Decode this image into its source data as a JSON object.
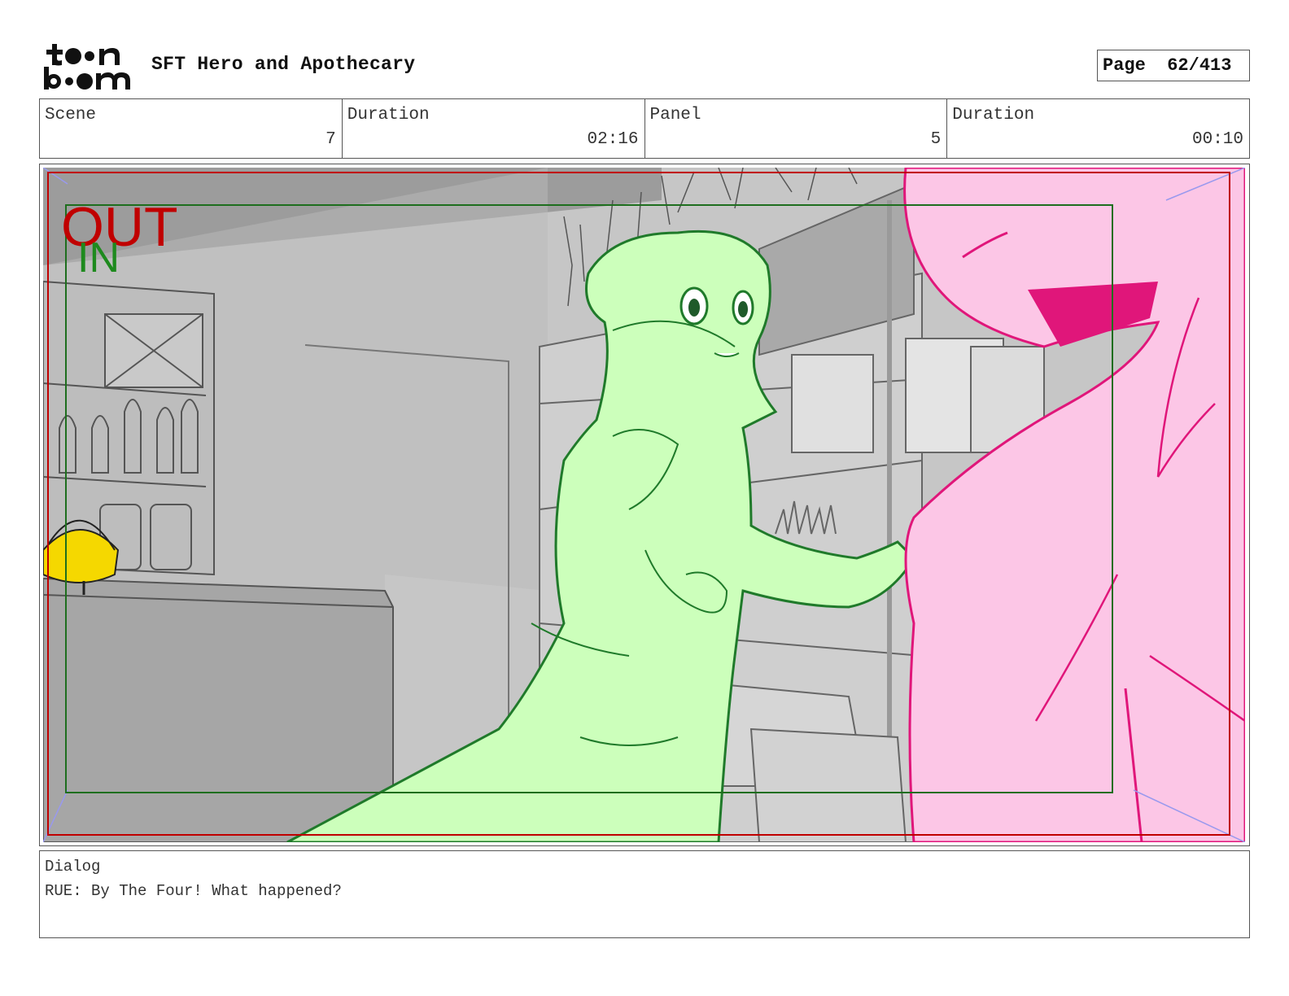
{
  "header": {
    "logo_text": "toon boom",
    "project_title": "SFT Hero and Apothecary",
    "page_label": "Page",
    "page_value": "62/413"
  },
  "info": {
    "scene_label": "Scene",
    "scene_value": "7",
    "scene_duration_label": "Duration",
    "scene_duration_value": "02:16",
    "panel_label": "Panel",
    "panel_value": "5",
    "panel_duration_label": "Duration",
    "panel_duration_value": "00:10"
  },
  "frame_guides": {
    "out_label": "OUT",
    "in_label": "IN",
    "out_color": "#c00000",
    "in_color": "#1e8a1e"
  },
  "dialog": {
    "label": "Dialog",
    "text": "RUE: By The Four! What happened?"
  },
  "colors": {
    "character_fill": "#ccffbb",
    "character_line": "#1f7a2a",
    "second_character_fill": "#fcc6e6",
    "second_character_line": "#e0167a",
    "background_gray": "#c4c4c4",
    "liquid_yellow": "#f5d800"
  }
}
